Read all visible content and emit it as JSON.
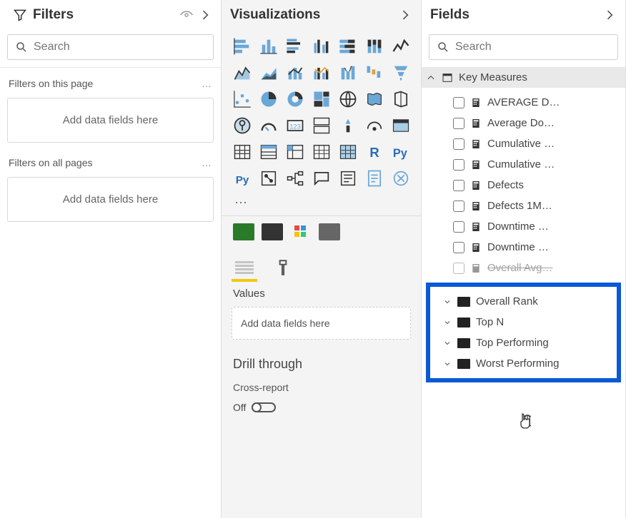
{
  "filters": {
    "title": "Filters",
    "search_placeholder": "Search",
    "section_page": "Filters on this page",
    "section_all": "Filters on all pages",
    "dropzone_text": "Add data fields here"
  },
  "viz": {
    "title": "Visualizations",
    "ellipsis": "···",
    "values_label": "Values",
    "values_drop": "Add data fields here",
    "drill_title": "Drill through",
    "cross_report_label": "Cross-report",
    "toggle_off": "Off"
  },
  "fields": {
    "title": "Fields",
    "search_placeholder": "Search",
    "table_name": "Key Measures",
    "measures": [
      "AVERAGE D…",
      "Average Do…",
      "Cumulative …",
      "Cumulative …",
      "Defects",
      "Defects 1M…",
      "Downtime …",
      "Downtime …",
      "Overall Avg…"
    ],
    "folders": [
      "Overall Rank",
      "Top N",
      "Top Performing",
      "Worst Performing"
    ]
  }
}
